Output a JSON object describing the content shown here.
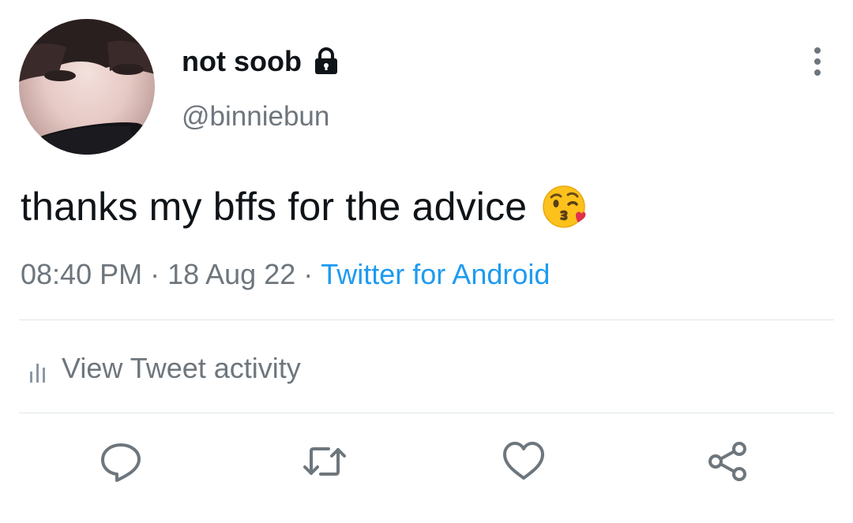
{
  "profile": {
    "display_name": "not soob",
    "handle": "@binniebun",
    "protected_icon": "lock-icon",
    "avatar_icon": "profile-photo"
  },
  "tweet": {
    "text": "thanks my bffs for the advice",
    "emoji": "face-blowing-a-kiss-icon",
    "time": "08:40 PM",
    "date": "18 Aug 22",
    "separator": "·",
    "source": "Twitter for Android"
  },
  "activity": {
    "label": "View Tweet activity",
    "icon": "bar-chart-icon"
  },
  "actions": [
    {
      "name": "reply",
      "icon": "reply-icon"
    },
    {
      "name": "retweet",
      "icon": "retweet-icon"
    },
    {
      "name": "like",
      "icon": "heart-icon"
    },
    {
      "name": "share",
      "icon": "share-icon"
    }
  ],
  "colors": {
    "text_primary": "#0f1419",
    "text_secondary": "#6e767d",
    "link": "#1d9bf0",
    "icon": "#6e767d",
    "divider": "#e1e6ea"
  }
}
